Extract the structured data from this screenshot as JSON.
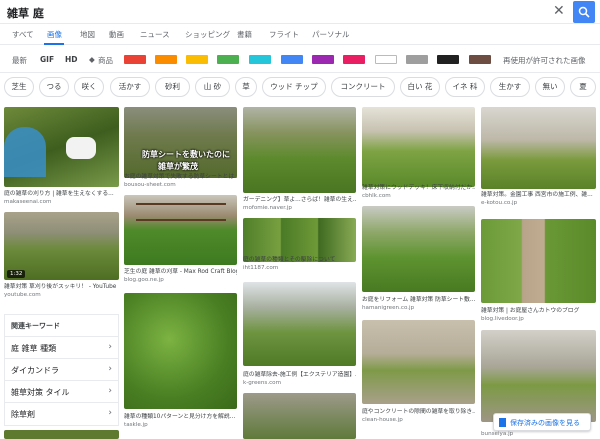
{
  "search": {
    "query": "雑草 庭"
  },
  "tabs": [
    "すべて",
    "画像",
    "地図",
    "動画",
    "ニュース",
    "ショッピング",
    "書籍",
    "フライト",
    "パーソナル"
  ],
  "tools": {
    "recent": "最新",
    "gif": "GIF",
    "hd": "HD",
    "product": "商品",
    "reuse": "再使用が許可された画像",
    "colors": [
      "#ea4335",
      "#fb8c00",
      "#fbbc04",
      "#4caf50",
      "#26c6da",
      "#4285f4",
      "#9c27b0",
      "#e91e63",
      "#ffffff",
      "#9e9e9e",
      "#212121",
      "#6d4c41"
    ]
  },
  "chips": [
    "芝生",
    "つる",
    "咲く",
    "活かす",
    "砂利",
    "山 砂",
    "草",
    "ウッド チップ",
    "コンクリート",
    "白い 花",
    "イネ 科",
    "生かす",
    "無い",
    "夏"
  ],
  "results": {
    "r1": {
      "caption": "庭の雑草の刈り方 | 雑草を生えなくする...",
      "source": "makaseenai.com"
    },
    "r2": {
      "caption": "お庭の雑草対策で失敗する防草シートとは...",
      "source": "bousou-sheet.com",
      "overlay1": "防草シートを敷いたのに",
      "overlay2": "雑草が繁茂"
    },
    "r3": {
      "caption": "ガーデニング】草よ...さらば！雑草の生え...",
      "source": "mofomie.naver.jp"
    },
    "r4": {
      "caption": "雑草対策にウッドデッキ！床下収納付だか...",
      "source": "cbhlk.com"
    },
    "r5": {
      "caption": "雑草対策。金園工事 西宮市の施工例、雑...",
      "source": "e-kotou.co.jp"
    },
    "r6": {
      "caption": "雑草対策 草刈り後がスッキリ！ - YouTube",
      "source": "youtube.com",
      "badge": "1:32"
    },
    "r7": {
      "caption": "芝生の庭 雑草の刈草 - Max Rod Craft Blog",
      "source": "blog.goo.ne.jp"
    },
    "r8": {
      "caption": "庭の雑草の種類とその駆除について",
      "source": "iht1187.com"
    },
    "r9": {
      "caption": "お庭をリフォーム 雑草対策 防草シート敷...",
      "source": "hamanigreen.co.jp"
    },
    "r10": {
      "caption": "雑草対策 | お庭屋さんカトウのブログ",
      "source": "blog.livedoor.jp"
    },
    "r11": {
      "caption": "庭の雑草除去-施工例【エクステリア造園】...",
      "source": "k-greens.com"
    },
    "r12": {
      "caption": "雑草の種類10パターンと見分け方を解説...",
      "source": "taskle.jp"
    },
    "r13": {
      "caption": "庭やコンクリートの隙間の雑草を取り除き...",
      "source": "clean-house.jp"
    },
    "r14": {
      "caption": "",
      "source": "bunseiya.jp"
    }
  },
  "keywords": {
    "title": "関連キーワード",
    "items": [
      "庭 雑草 種類",
      "ダイカンドラ",
      "雑草対策 タイル",
      "除草剤"
    ]
  },
  "saved_button": "保存済みの画像を見る"
}
